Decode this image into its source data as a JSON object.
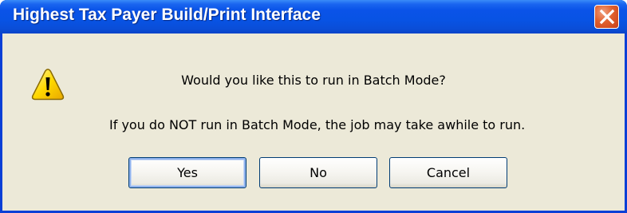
{
  "window": {
    "title": "Highest Tax Payer Build/Print Interface"
  },
  "icons": {
    "warning": "warning-icon",
    "close": "close-icon"
  },
  "message": {
    "line1": "Would you like this to run in Batch Mode?",
    "line2": "If you do NOT run in Batch Mode, the job may take awhile to run."
  },
  "buttons": {
    "yes": "Yes",
    "no": "No",
    "cancel": "Cancel"
  },
  "colors": {
    "titlebar": "#0a53e8",
    "dialog_background": "#ece9d8",
    "close_button": "#e0602e",
    "warning_fill": "#ffd200"
  }
}
